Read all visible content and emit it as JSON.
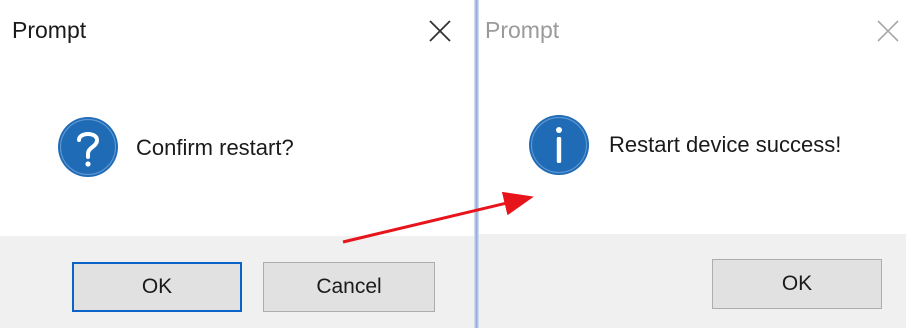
{
  "confirm_dialog": {
    "title": "Prompt",
    "icon": "question-icon",
    "message": "Confirm restart?",
    "ok_label": "OK",
    "cancel_label": "Cancel"
  },
  "result_dialog": {
    "title": "Prompt",
    "icon": "info-icon",
    "message": "Restart device success!",
    "ok_label": "OK"
  },
  "colors": {
    "icon_blue": "#1f6bb5",
    "focus_border": "#0a64c8",
    "arrow": "#e8141b",
    "footer_bg": "#f0f0f0"
  }
}
